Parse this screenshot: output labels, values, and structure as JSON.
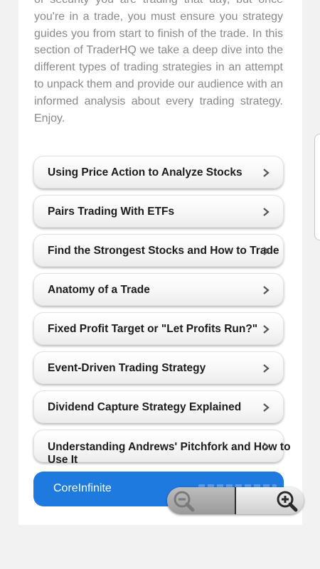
{
  "intro_text": "of security you are trading that day, but once you're in a trade, you must ensure you strategy guides you from start to finish of the trade. In this section of TraderHQ we take a deep dive into the different types of trading strategies in an attempt to unpack them and provide our audience with an informed analysis about every trading strategy. Enjoy.",
  "menu": [
    {
      "label": "Using Price Action to Analyze Stocks"
    },
    {
      "label": "Pairs Trading With ETFs"
    },
    {
      "label": "Find the Strongest Stocks and How to Trade"
    },
    {
      "label": "Anatomy of a Trade"
    },
    {
      "label": "Fixed Profit Target or \"Let Profits Run?\""
    },
    {
      "label": "Event-Driven Trading Strategy"
    },
    {
      "label": "Dividend Capture Strategy Explained"
    },
    {
      "label": "Understanding Andrews' Pitchfork and How to Use It"
    }
  ],
  "cta": {
    "label": "CoreInfinite"
  },
  "icons": {
    "menu_chevron": "chevron-right-icon",
    "zoom_out": "zoom-out-icon",
    "zoom_in": "zoom-in-icon"
  },
  "colors": {
    "accent": "#1f7ae0",
    "text": "#1c1c1c",
    "muted": "#8a8a8a"
  }
}
